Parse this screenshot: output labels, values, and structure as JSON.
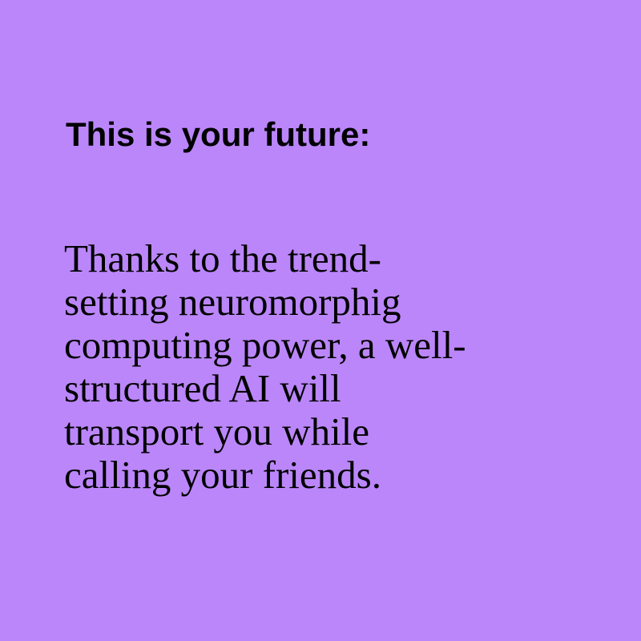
{
  "colors": {
    "background": "#bb86fa",
    "text": "#000000"
  },
  "heading": "This is your future:",
  "body_lines": [
    "Thanks to the trend-",
    "setting neuromorphig",
    "computing power, a well-",
    "structured AI will",
    "transport you while",
    "calling your friends."
  ]
}
